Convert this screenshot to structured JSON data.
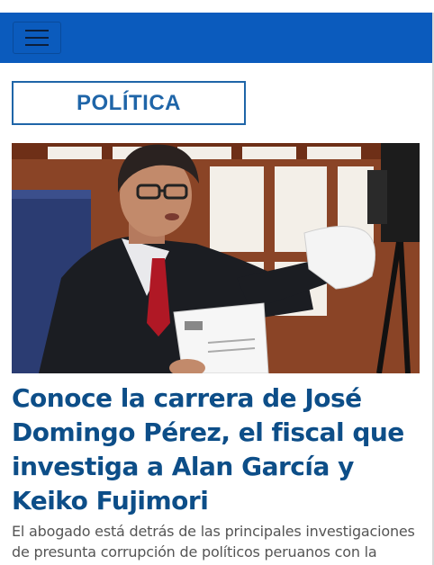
{
  "navbar": {
    "menu_icon": "hamburger-menu-icon",
    "color": "#0b5bbd"
  },
  "section": {
    "label": "POLÍTICA",
    "accent": "#1f65a8"
  },
  "article": {
    "headline": "Conoce la carrera de José Domingo Pérez, el fiscal que investiga a Alan García y Keiko Fujimori",
    "summary": "El abogado está detrás de las principales investigaciones de presunta corrupción de políticos peruanos con la",
    "headline_color": "#0d4e88"
  }
}
